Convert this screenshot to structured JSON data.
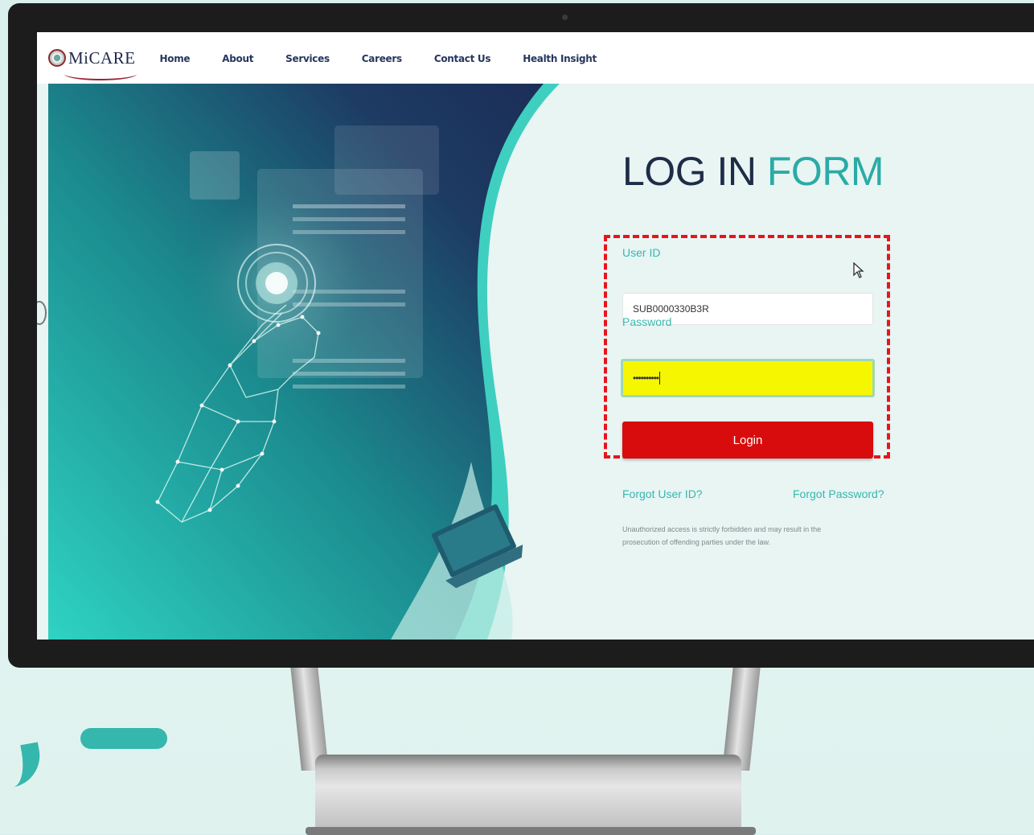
{
  "brand": {
    "logo_text": "MiCARE"
  },
  "nav": {
    "items": [
      {
        "label": "Home"
      },
      {
        "label": "About"
      },
      {
        "label": "Services"
      },
      {
        "label": "Careers"
      },
      {
        "label": "Contact Us"
      },
      {
        "label": "Health Insight"
      }
    ]
  },
  "login_form": {
    "title_part1": "LOG IN",
    "title_part2": "FORM",
    "userid_label": "User ID",
    "userid_value": "SUB0000330B3R",
    "password_label": "Password",
    "password_value": "••••••••••",
    "login_button": "Login",
    "forgot_userid": "Forgot User ID?",
    "forgot_password": "Forgot Password?",
    "disclaimer": "Unauthorized access is strictly forbidden and may result in the prosecution of offending parties under the law."
  },
  "colors": {
    "accent_teal": "#35b7ad",
    "title_dark": "#1e2c48",
    "login_button": "#d80c0c",
    "password_highlight": "#f6f600",
    "annotation_dash": "#e8141c"
  },
  "icons": [
    "logo-emblem-icon",
    "mouse-cursor-icon",
    "scroll-arrow-icon"
  ]
}
